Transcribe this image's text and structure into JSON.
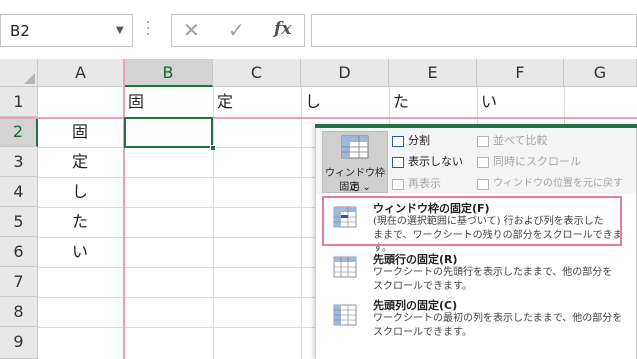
{
  "formula_bar": {
    "name_box": "B2",
    "fx_label": "fx",
    "formula_value": ""
  },
  "columns": [
    {
      "key": "A",
      "label": "A"
    },
    {
      "key": "B",
      "label": "B"
    },
    {
      "key": "C",
      "label": "C"
    },
    {
      "key": "D",
      "label": "D"
    },
    {
      "key": "E",
      "label": "E"
    },
    {
      "key": "F",
      "label": "F"
    },
    {
      "key": "G",
      "label": "G"
    }
  ],
  "rows": [
    "1",
    "2",
    "3",
    "4",
    "5",
    "6",
    "7",
    "8",
    "9"
  ],
  "row1_cells": {
    "B": "固",
    "C": "定",
    "D": "し",
    "E": "た",
    "F": "い"
  },
  "colA_cells": {
    "2": "固",
    "3": "定",
    "4": "し",
    "5": "た",
    "6": "い"
  },
  "ribbon": {
    "freeze_button_line1": "ウィンドウ枠の",
    "freeze_button_line2": "固定 ⌄",
    "split": "分割",
    "hide": "表示しない",
    "unhide": "再表示",
    "side_by_side": "並べて比較",
    "sync_scroll": "同時にスクロール",
    "reset_position": "ウィンドウの位置を元に戻す"
  },
  "menu": {
    "items": [
      {
        "title": "ウィンドウ枠の固定(F)",
        "desc1": "(現在の選択範囲に基づいて) 行および列を表示した",
        "desc2": "ままで、ワークシートの残りの部分をスクロールできます。"
      },
      {
        "title": "先頭行の固定(R)",
        "desc1": "ワークシートの先頭行を表示したままで、他の部分を",
        "desc2": "スクロールできます。"
      },
      {
        "title": "先頭列の固定(C)",
        "desc1": "ワークシートの最初の列を表示したままで、他の部分を",
        "desc2": "スクロールできます。"
      }
    ]
  },
  "colors": {
    "accent": "#217346",
    "freeze_line": "#e8a2c0",
    "highlight_border": "#e37aa8"
  }
}
